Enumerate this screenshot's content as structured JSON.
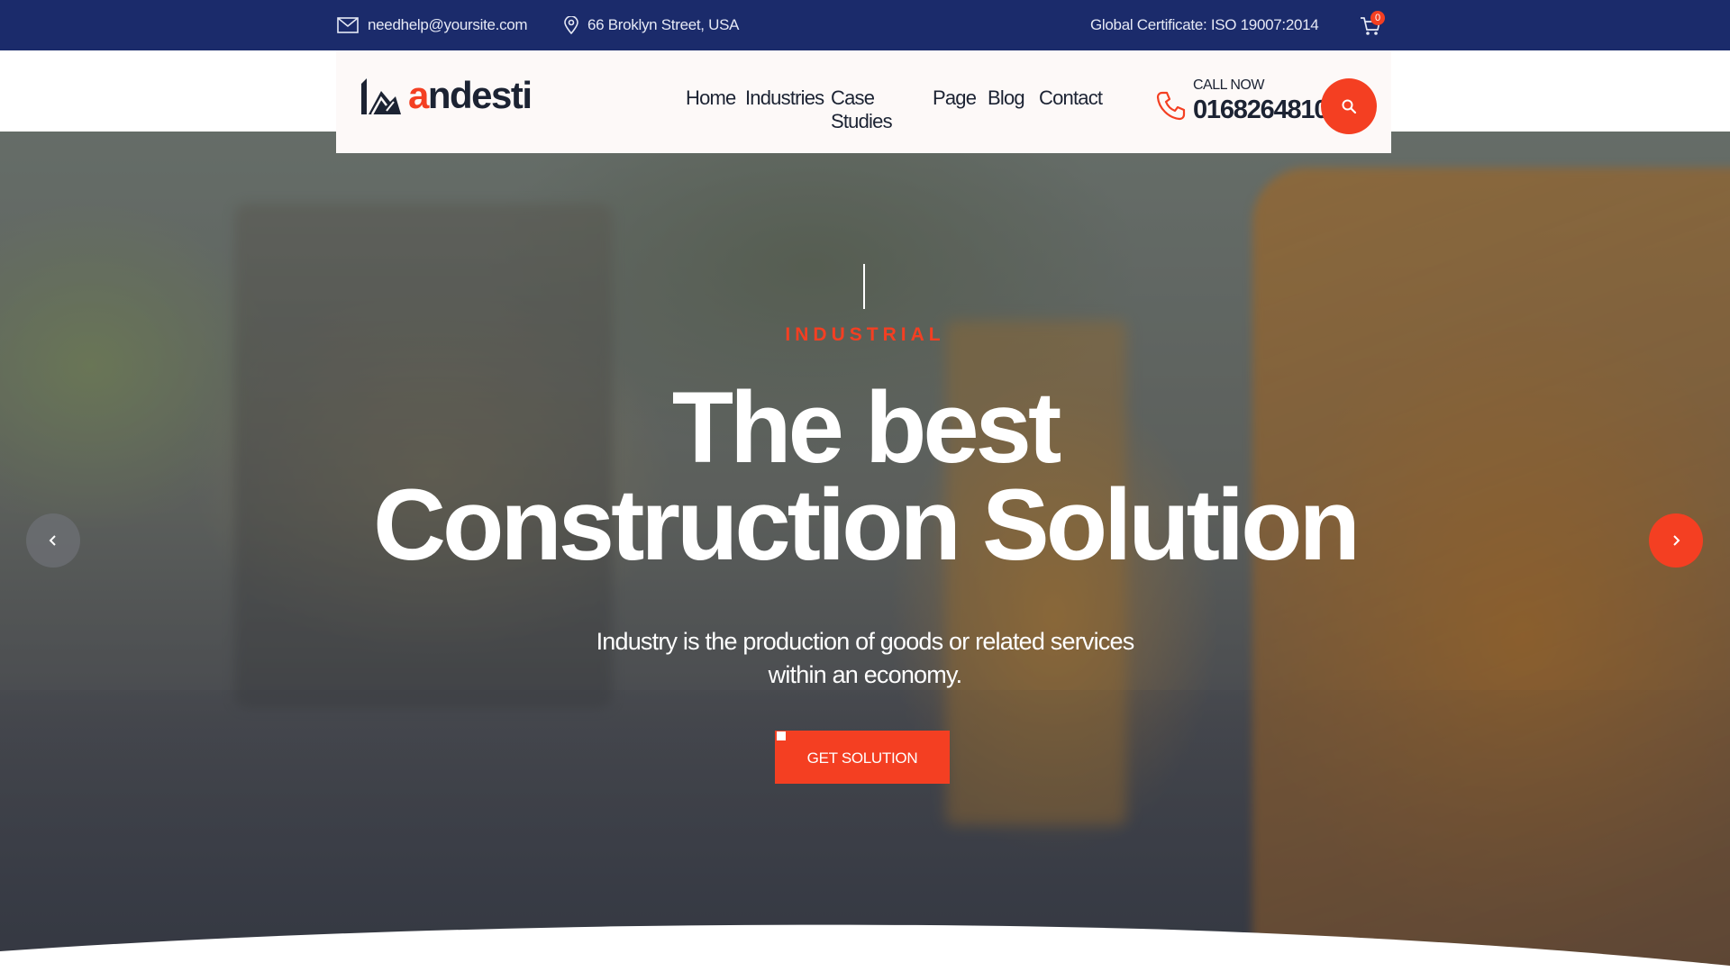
{
  "topbar": {
    "email": "needhelp@yoursite.com",
    "address": "66 Broklyn Street, USA",
    "certificate": "Global Certificate: ISO 19007:2014",
    "cart_count": "0"
  },
  "header": {
    "logo_first": "a",
    "logo_rest": "ndesti",
    "nav": [
      "Home",
      "Industries",
      "Case Studies",
      "Page",
      "Blog",
      "Contact"
    ],
    "call_label": "CALL NOW",
    "call_number": "01682648101"
  },
  "hero": {
    "tag": "INDUSTRIAL",
    "title_line1": "The best",
    "title_line2": "Construction Solution",
    "subtitle": "Industry is the production of goods or related services within an economy.",
    "cta": "GET SOLUTION"
  },
  "colors": {
    "topbar_bg": "#1b2b6b",
    "accent": "#f43f22",
    "dark_text": "#1c2333",
    "header_bg": "#fdf9f8"
  },
  "icons": [
    "envelope-icon",
    "map-pin-icon",
    "cart-icon",
    "phone-icon",
    "search-icon",
    "chevron-left-icon",
    "chevron-right-icon"
  ]
}
